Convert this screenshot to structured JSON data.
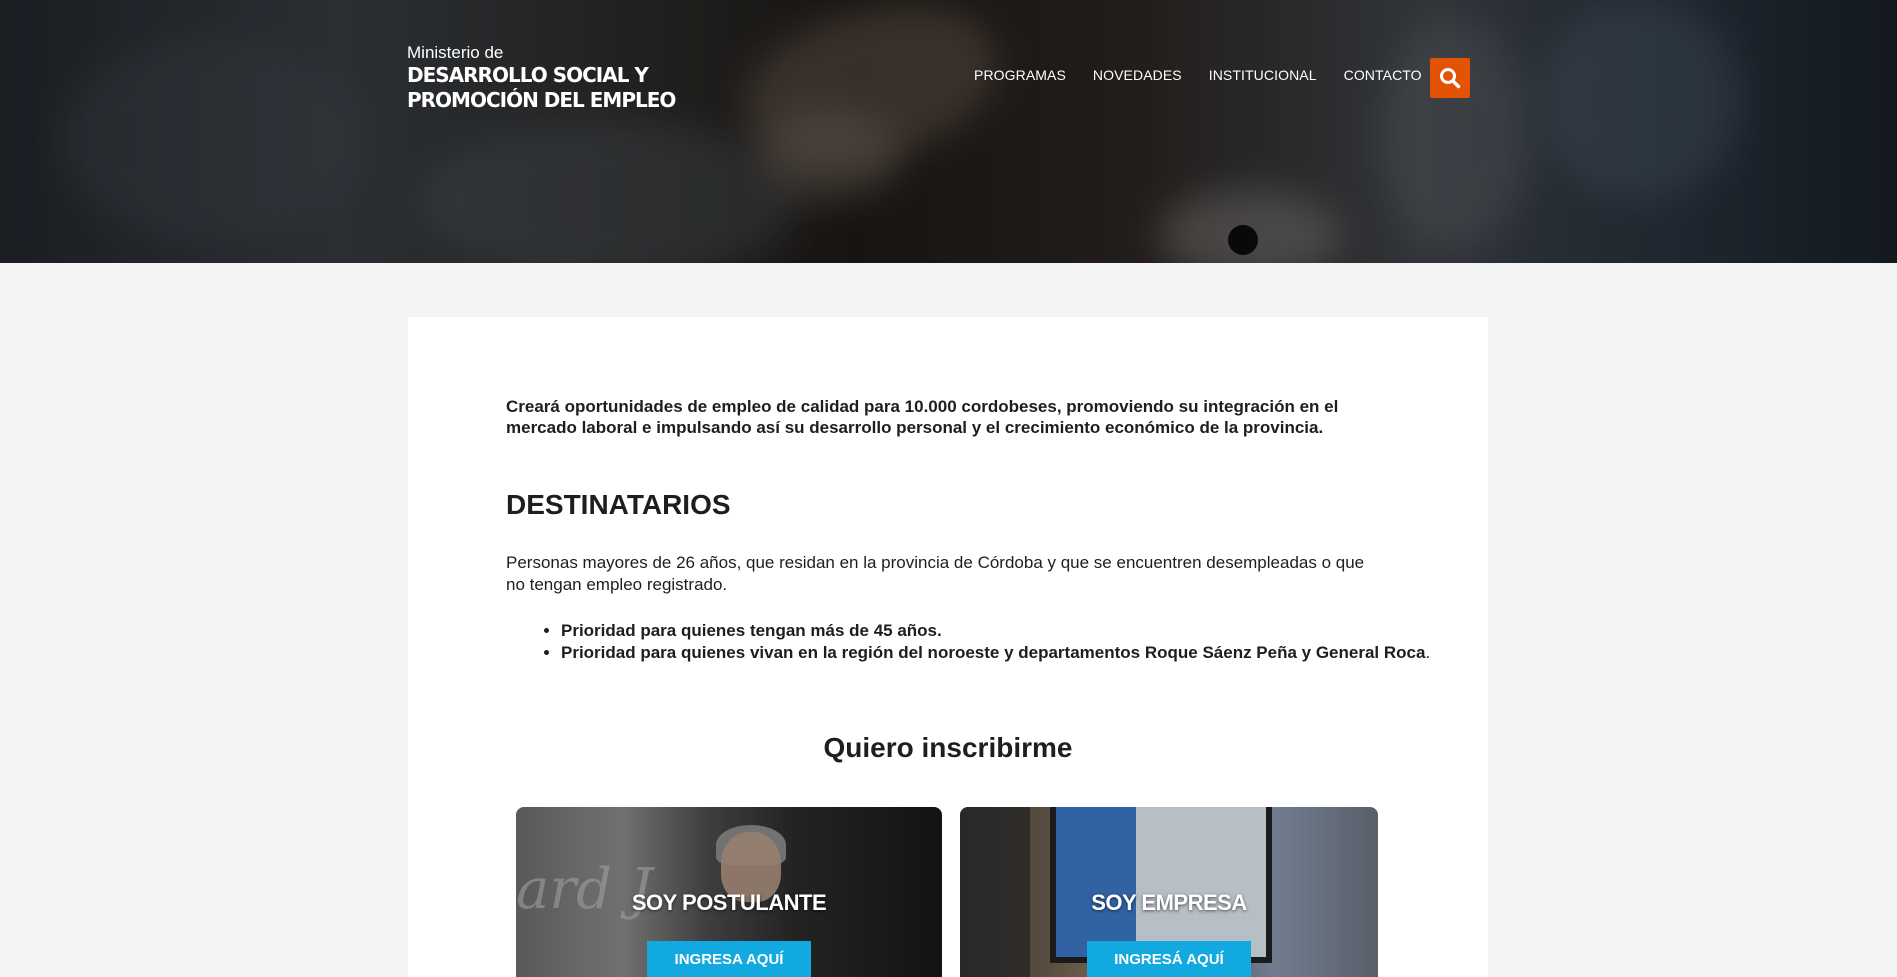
{
  "brand": {
    "pre": "Ministerio de",
    "line1": "DESARROLLO SOCIAL Y",
    "line2": "PROMOCIÓN DEL EMPLEO"
  },
  "nav": {
    "items": [
      {
        "label": "PROGRAMAS"
      },
      {
        "label": "NOVEDADES"
      },
      {
        "label": "INSTITUCIONAL"
      },
      {
        "label": "CONTACTO"
      }
    ]
  },
  "search": {
    "icon": "search-icon",
    "color": "#e35205"
  },
  "content": {
    "intro": "Creará oportunidades de empleo de calidad para 10.000 cordobeses, promoviendo su integración en el mercado laboral e impulsando así su desarrollo personal y el crecimiento económico de la provincia.",
    "heading": "DESTINATARIOS",
    "description": "Personas mayores de 26 años, que residan en la provincia de Córdoba y que se encuentren desempleadas o que no tengan empleo registrado.",
    "bullets": [
      {
        "bold": "Prioridad para quienes tengan más de 45 años.",
        "tail": ""
      },
      {
        "bold": "Prioridad para quienes vivan en la región del noroeste y departamentos Roque Sáenz Peña y General Roca",
        "tail": "."
      }
    ],
    "subheading": "Quiero inscribirme"
  },
  "tiles": [
    {
      "title": "SOY POSTULANTE",
      "button": "INGRESA AQUÍ"
    },
    {
      "title": "SOY EMPRESA",
      "button": "INGRESÁ AQUÍ"
    }
  ],
  "colors": {
    "accent": "#e35205",
    "button_blue": "#12a9e0"
  }
}
